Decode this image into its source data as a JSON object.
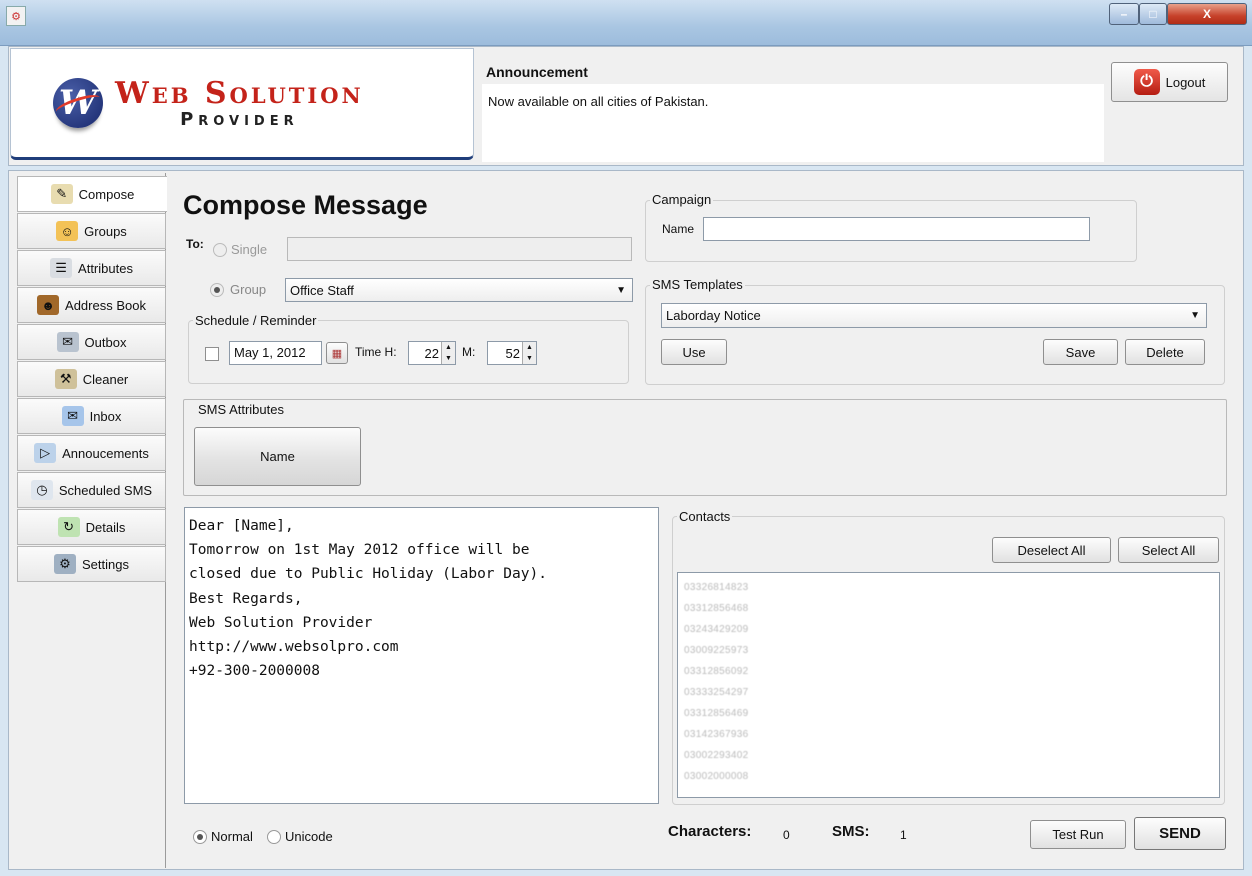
{
  "window": {
    "minimize_label": "–",
    "maximize_label": "□",
    "close_label": "X"
  },
  "logo": {
    "mark": "W",
    "line1": "Web Solution",
    "line2": "Provider"
  },
  "announcement": {
    "title": "Announcement",
    "text": "Now available on all cities of Pakistan."
  },
  "logout": {
    "label": "Logout",
    "icon_glyph": "⏻"
  },
  "sidebar": {
    "items": [
      {
        "label": "Compose",
        "icon": "compose-icon",
        "glyph": "✎",
        "color": "#e8dcb0"
      },
      {
        "label": "Groups",
        "icon": "groups-icon",
        "glyph": "☺",
        "color": "#f3c257"
      },
      {
        "label": "Attributes",
        "icon": "attributes-icon",
        "glyph": "☰",
        "color": "#d9dde2"
      },
      {
        "label": "Address Book",
        "icon": "address-book-icon",
        "glyph": "☻",
        "color": "#a1682a"
      },
      {
        "label": "Outbox",
        "icon": "outbox-icon",
        "glyph": "✉",
        "color": "#b9c3cf"
      },
      {
        "label": "Cleaner",
        "icon": "cleaner-icon",
        "glyph": "⚒",
        "color": "#cfc19a"
      },
      {
        "label": "Inbox",
        "icon": "inbox-icon",
        "glyph": "✉",
        "color": "#a6c5ea"
      },
      {
        "label": "Annoucements",
        "icon": "announcements-icon",
        "glyph": "▷",
        "color": "#bcd2ea"
      },
      {
        "label": "Scheduled SMS",
        "icon": "clock-icon",
        "glyph": "◷",
        "color": "#dfe6ee"
      },
      {
        "label": "Details",
        "icon": "details-icon",
        "glyph": "↻",
        "color": "#bfe3b2"
      },
      {
        "label": "Settings",
        "icon": "settings-icon",
        "glyph": "⚙",
        "color": "#9fb0c2"
      }
    ]
  },
  "compose": {
    "title": "Compose Message",
    "to_label": "To:",
    "single_label": "Single",
    "single_value": "",
    "group_label": "Group",
    "group_value": "Office Staff",
    "schedule_legend": "Schedule / Reminder",
    "date_value": "May 1, 2012",
    "time_h_label": "Time H:",
    "hour_value": "22",
    "minute_label": "M:",
    "minute_value": "52"
  },
  "campaign": {
    "legend": "Campaign",
    "name_label": "Name",
    "name_value": ""
  },
  "templates": {
    "legend": "SMS Templates",
    "selected": "Laborday Notice",
    "use_label": "Use",
    "save_label": "Save",
    "delete_label": "Delete"
  },
  "attributes": {
    "legend": "SMS Attributes",
    "name_button": "Name"
  },
  "message": {
    "text": "Dear [Name],\nTomorrow on 1st May 2012 office will be\nclosed due to Public Holiday (Labor Day).\nBest Regards,\nWeb Solution Provider\nhttp://www.websolpro.com\n+92-300-2000008"
  },
  "contacts": {
    "legend": "Contacts",
    "deselect_all_label": "Deselect All",
    "select_all_label": "Select All",
    "items": [
      "03326814823",
      "03312856468",
      "03243429209",
      "03009225973",
      "03312856092",
      "03333254297",
      "03312856469",
      "03142367936",
      "03002293402",
      "03002000008"
    ]
  },
  "footer": {
    "normal_label": "Normal",
    "unicode_label": "Unicode",
    "characters_label": "Characters:",
    "characters_value": "0",
    "sms_label": "SMS:",
    "sms_value": "1",
    "test_run_label": "Test Run",
    "send_label": "SEND"
  }
}
